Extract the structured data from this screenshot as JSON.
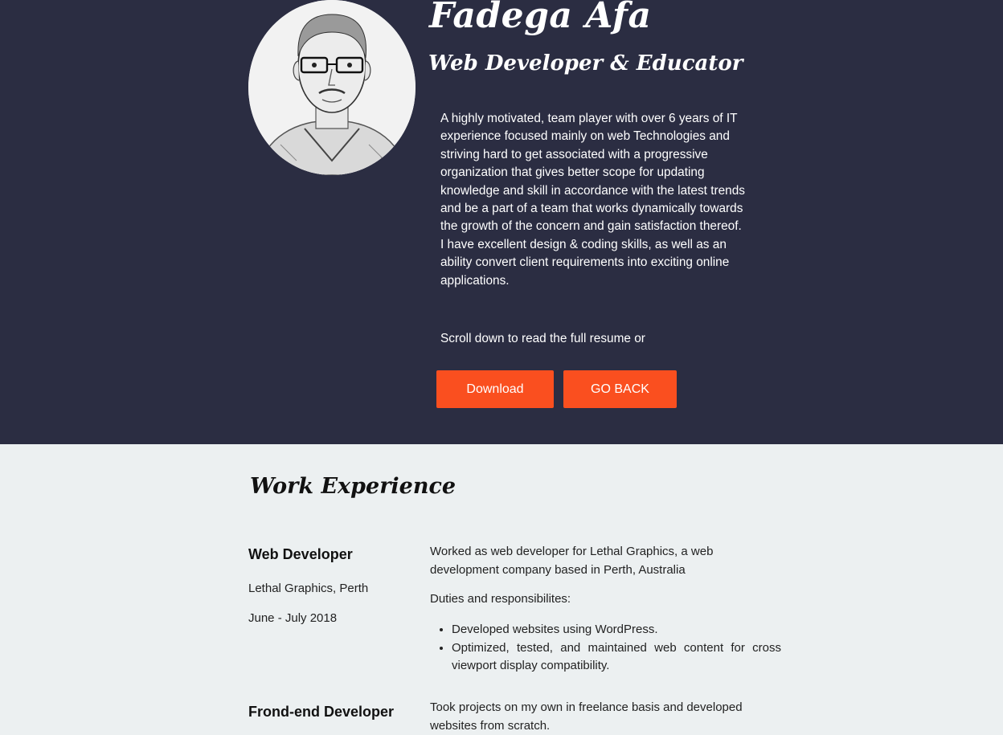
{
  "hero": {
    "name": "Fadega Afa",
    "role": "Web Developer & Educator",
    "bio": "A highly motivated, team player with over 6 years of IT experience focused mainly on web Technologies and striving hard to get associated with a progressive organization that gives better scope for updating knowledge and skill in accordance with the latest trends and be a part of a team that works dynamically towards the growth of the concern and gain satisfaction thereof. I have excellent design & coding skills, as well as an ability convert client requirements into exciting online applications.",
    "scroll_note": "Scroll down to read the full resume or",
    "download_label": "Download",
    "back_label": "GO BACK",
    "avatar_icon": "profile-photo"
  },
  "experience": {
    "title": "Work Experience",
    "jobs": [
      {
        "title": "Web Developer",
        "company": "Lethal Graphics, Perth",
        "dates": "June - July 2018",
        "summary": "Worked as web developer for Lethal Graphics, a web development company based in Perth, Australia",
        "duties_heading": "Duties and responsibilites:",
        "duties": [
          "Developed websites using WordPress.",
          "Optimized, tested, and maintained web content for cross viewport display compatibility."
        ]
      },
      {
        "title": "Frond-end Developer",
        "summary": "Took projects on my own in freelance basis and developed websites from scratch."
      }
    ]
  },
  "colors": {
    "hero_bg": "#2b2d42",
    "accent": "#fa4f1f",
    "page_bg": "#ecf0f1"
  }
}
